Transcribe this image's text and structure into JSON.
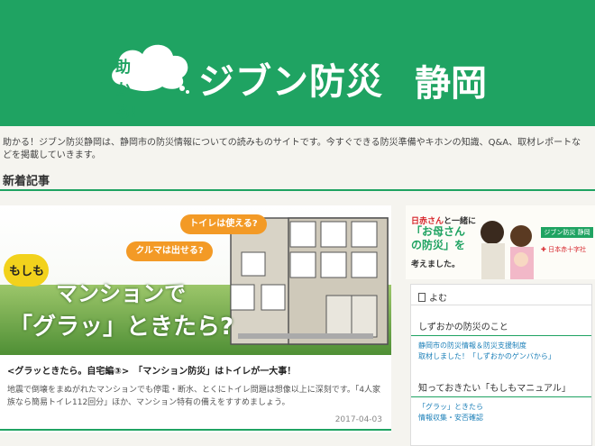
{
  "header": {
    "cloud_text": "助かる!",
    "brand": "ジブン防災",
    "city": "静岡",
    "bg_color": "#1fa362"
  },
  "intro": "助かる！ジブン防災静岡は、静岡市の防災情報についての読みものサイトです。今すぐできる防災準備やキホンの知識、Q&A、取材レポートなどを掲載していきます。",
  "section_title": "新着記事",
  "card": {
    "bubble_toilet": "トイレは使える?",
    "bubble_car": "クルマは出せる?",
    "moshimo": "もしも",
    "headline_1": "マンションで",
    "headline_2": "「グラッ」ときたら?",
    "title": "<グラッときたら。自宅編③>　「マンション防災」はトイレが一大事！",
    "excerpt": "地震で倒壊をまぬがれたマンションでも停電・断水、とくにトイレ問題は想像以上に深刻です。「4人家族なら簡易トイレ112回分」ほか、マンション特有の備えをすすめましょう。",
    "date": "2017-04-03"
  },
  "banner": {
    "line1_red": "日赤さん",
    "line1_rest": "と一緒に",
    "line2": "「お母さんの防災」を",
    "line3": "考えました。",
    "tag": "ジブン防災 静岡",
    "redcross": "日本赤十字社"
  },
  "sidebox": {
    "head": "よむ",
    "section1": "しずおかの防災のこと",
    "section1_links": [
      "静岡市の防災情報＆防災支援制度",
      "取材しました！「しずおかのゲンバから」"
    ],
    "section2": "知っておきたい「もしもマニュアル」",
    "section2_links": [
      "「グラッ」ときたら",
      "情報収集・安否確認"
    ]
  }
}
